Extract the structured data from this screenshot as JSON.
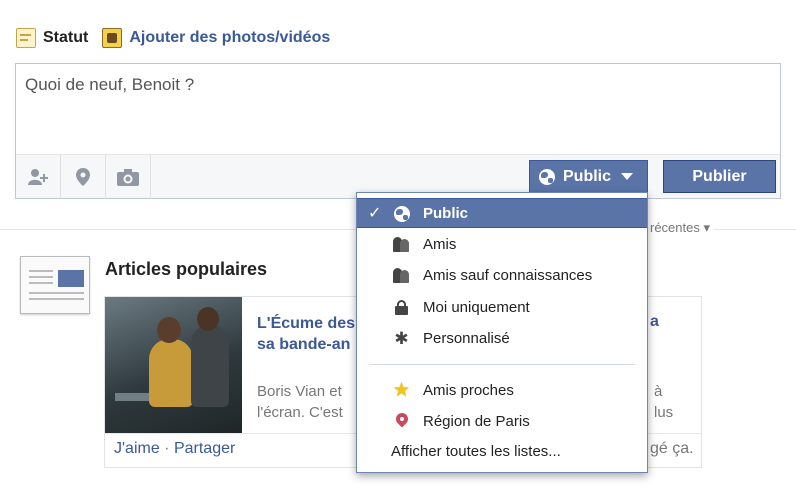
{
  "composer": {
    "tabs": [
      {
        "label": "Statut",
        "icon": "status-note-icon"
      },
      {
        "label": "Ajouter des photos/vidéos",
        "icon": "photo-icon"
      }
    ],
    "placeholder": "Quoi de neuf, Benoit ?",
    "toolbar_icons": [
      "tag-friends-icon",
      "location-pin-icon",
      "camera-icon"
    ],
    "audience_button": "Public",
    "publish_button": "Publier"
  },
  "feed": {
    "sort_label": "récentes ▾",
    "section_title": "Articles populaires",
    "article": {
      "title_line1": "L'Écume des",
      "title_line2": "sa bande-an",
      "title_right": "a",
      "text_line1": "Boris Vian et",
      "text_line2": "l'écran. C'est",
      "text_right_line1": "à",
      "text_right_line2": "lus",
      "actions": {
        "like": "J'aime",
        "separator": " · ",
        "share": "Partager"
      },
      "footer_right": "gé ça."
    }
  },
  "audience_menu": {
    "items": [
      {
        "label": "Public",
        "icon": "globe-icon",
        "selected": true
      },
      {
        "label": "Amis",
        "icon": "friends-icon",
        "selected": false
      },
      {
        "label": "Amis sauf connaissances",
        "icon": "friends-except-icon",
        "selected": false
      },
      {
        "label": "Moi uniquement",
        "icon": "lock-icon",
        "selected": false
      },
      {
        "label": "Personnalisé",
        "icon": "gear-icon",
        "selected": false
      },
      {
        "label": "Amis proches",
        "icon": "star-icon",
        "selected": false
      },
      {
        "label": "Région de Paris",
        "icon": "location-pin-icon",
        "selected": false
      }
    ],
    "check_mark": "✓",
    "show_all": "Afficher toutes les listes..."
  },
  "colors": {
    "brand": "#3b5998",
    "button": "#5b74a8",
    "highlight": "#5b74a8"
  }
}
